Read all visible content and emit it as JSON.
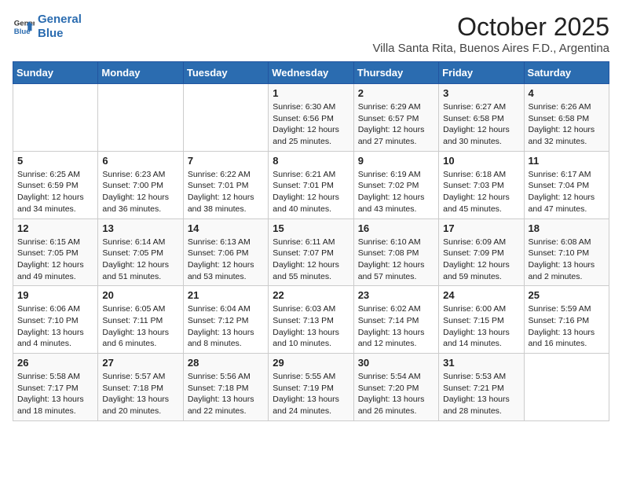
{
  "header": {
    "logo_line1": "General",
    "logo_line2": "Blue",
    "title": "October 2025",
    "subtitle": "Villa Santa Rita, Buenos Aires F.D., Argentina"
  },
  "weekdays": [
    "Sunday",
    "Monday",
    "Tuesday",
    "Wednesday",
    "Thursday",
    "Friday",
    "Saturday"
  ],
  "weeks": [
    [
      {
        "day": "",
        "sunrise": "",
        "sunset": "",
        "daylight": ""
      },
      {
        "day": "",
        "sunrise": "",
        "sunset": "",
        "daylight": ""
      },
      {
        "day": "",
        "sunrise": "",
        "sunset": "",
        "daylight": ""
      },
      {
        "day": "1",
        "sunrise": "Sunrise: 6:30 AM",
        "sunset": "Sunset: 6:56 PM",
        "daylight": "Daylight: 12 hours and 25 minutes."
      },
      {
        "day": "2",
        "sunrise": "Sunrise: 6:29 AM",
        "sunset": "Sunset: 6:57 PM",
        "daylight": "Daylight: 12 hours and 27 minutes."
      },
      {
        "day": "3",
        "sunrise": "Sunrise: 6:27 AM",
        "sunset": "Sunset: 6:58 PM",
        "daylight": "Daylight: 12 hours and 30 minutes."
      },
      {
        "day": "4",
        "sunrise": "Sunrise: 6:26 AM",
        "sunset": "Sunset: 6:58 PM",
        "daylight": "Daylight: 12 hours and 32 minutes."
      }
    ],
    [
      {
        "day": "5",
        "sunrise": "Sunrise: 6:25 AM",
        "sunset": "Sunset: 6:59 PM",
        "daylight": "Daylight: 12 hours and 34 minutes."
      },
      {
        "day": "6",
        "sunrise": "Sunrise: 6:23 AM",
        "sunset": "Sunset: 7:00 PM",
        "daylight": "Daylight: 12 hours and 36 minutes."
      },
      {
        "day": "7",
        "sunrise": "Sunrise: 6:22 AM",
        "sunset": "Sunset: 7:01 PM",
        "daylight": "Daylight: 12 hours and 38 minutes."
      },
      {
        "day": "8",
        "sunrise": "Sunrise: 6:21 AM",
        "sunset": "Sunset: 7:01 PM",
        "daylight": "Daylight: 12 hours and 40 minutes."
      },
      {
        "day": "9",
        "sunrise": "Sunrise: 6:19 AM",
        "sunset": "Sunset: 7:02 PM",
        "daylight": "Daylight: 12 hours and 43 minutes."
      },
      {
        "day": "10",
        "sunrise": "Sunrise: 6:18 AM",
        "sunset": "Sunset: 7:03 PM",
        "daylight": "Daylight: 12 hours and 45 minutes."
      },
      {
        "day": "11",
        "sunrise": "Sunrise: 6:17 AM",
        "sunset": "Sunset: 7:04 PM",
        "daylight": "Daylight: 12 hours and 47 minutes."
      }
    ],
    [
      {
        "day": "12",
        "sunrise": "Sunrise: 6:15 AM",
        "sunset": "Sunset: 7:05 PM",
        "daylight": "Daylight: 12 hours and 49 minutes."
      },
      {
        "day": "13",
        "sunrise": "Sunrise: 6:14 AM",
        "sunset": "Sunset: 7:05 PM",
        "daylight": "Daylight: 12 hours and 51 minutes."
      },
      {
        "day": "14",
        "sunrise": "Sunrise: 6:13 AM",
        "sunset": "Sunset: 7:06 PM",
        "daylight": "Daylight: 12 hours and 53 minutes."
      },
      {
        "day": "15",
        "sunrise": "Sunrise: 6:11 AM",
        "sunset": "Sunset: 7:07 PM",
        "daylight": "Daylight: 12 hours and 55 minutes."
      },
      {
        "day": "16",
        "sunrise": "Sunrise: 6:10 AM",
        "sunset": "Sunset: 7:08 PM",
        "daylight": "Daylight: 12 hours and 57 minutes."
      },
      {
        "day": "17",
        "sunrise": "Sunrise: 6:09 AM",
        "sunset": "Sunset: 7:09 PM",
        "daylight": "Daylight: 12 hours and 59 minutes."
      },
      {
        "day": "18",
        "sunrise": "Sunrise: 6:08 AM",
        "sunset": "Sunset: 7:10 PM",
        "daylight": "Daylight: 13 hours and 2 minutes."
      }
    ],
    [
      {
        "day": "19",
        "sunrise": "Sunrise: 6:06 AM",
        "sunset": "Sunset: 7:10 PM",
        "daylight": "Daylight: 13 hours and 4 minutes."
      },
      {
        "day": "20",
        "sunrise": "Sunrise: 6:05 AM",
        "sunset": "Sunset: 7:11 PM",
        "daylight": "Daylight: 13 hours and 6 minutes."
      },
      {
        "day": "21",
        "sunrise": "Sunrise: 6:04 AM",
        "sunset": "Sunset: 7:12 PM",
        "daylight": "Daylight: 13 hours and 8 minutes."
      },
      {
        "day": "22",
        "sunrise": "Sunrise: 6:03 AM",
        "sunset": "Sunset: 7:13 PM",
        "daylight": "Daylight: 13 hours and 10 minutes."
      },
      {
        "day": "23",
        "sunrise": "Sunrise: 6:02 AM",
        "sunset": "Sunset: 7:14 PM",
        "daylight": "Daylight: 13 hours and 12 minutes."
      },
      {
        "day": "24",
        "sunrise": "Sunrise: 6:00 AM",
        "sunset": "Sunset: 7:15 PM",
        "daylight": "Daylight: 13 hours and 14 minutes."
      },
      {
        "day": "25",
        "sunrise": "Sunrise: 5:59 AM",
        "sunset": "Sunset: 7:16 PM",
        "daylight": "Daylight: 13 hours and 16 minutes."
      }
    ],
    [
      {
        "day": "26",
        "sunrise": "Sunrise: 5:58 AM",
        "sunset": "Sunset: 7:17 PM",
        "daylight": "Daylight: 13 hours and 18 minutes."
      },
      {
        "day": "27",
        "sunrise": "Sunrise: 5:57 AM",
        "sunset": "Sunset: 7:18 PM",
        "daylight": "Daylight: 13 hours and 20 minutes."
      },
      {
        "day": "28",
        "sunrise": "Sunrise: 5:56 AM",
        "sunset": "Sunset: 7:18 PM",
        "daylight": "Daylight: 13 hours and 22 minutes."
      },
      {
        "day": "29",
        "sunrise": "Sunrise: 5:55 AM",
        "sunset": "Sunset: 7:19 PM",
        "daylight": "Daylight: 13 hours and 24 minutes."
      },
      {
        "day": "30",
        "sunrise": "Sunrise: 5:54 AM",
        "sunset": "Sunset: 7:20 PM",
        "daylight": "Daylight: 13 hours and 26 minutes."
      },
      {
        "day": "31",
        "sunrise": "Sunrise: 5:53 AM",
        "sunset": "Sunset: 7:21 PM",
        "daylight": "Daylight: 13 hours and 28 minutes."
      },
      {
        "day": "",
        "sunrise": "",
        "sunset": "",
        "daylight": ""
      }
    ]
  ]
}
